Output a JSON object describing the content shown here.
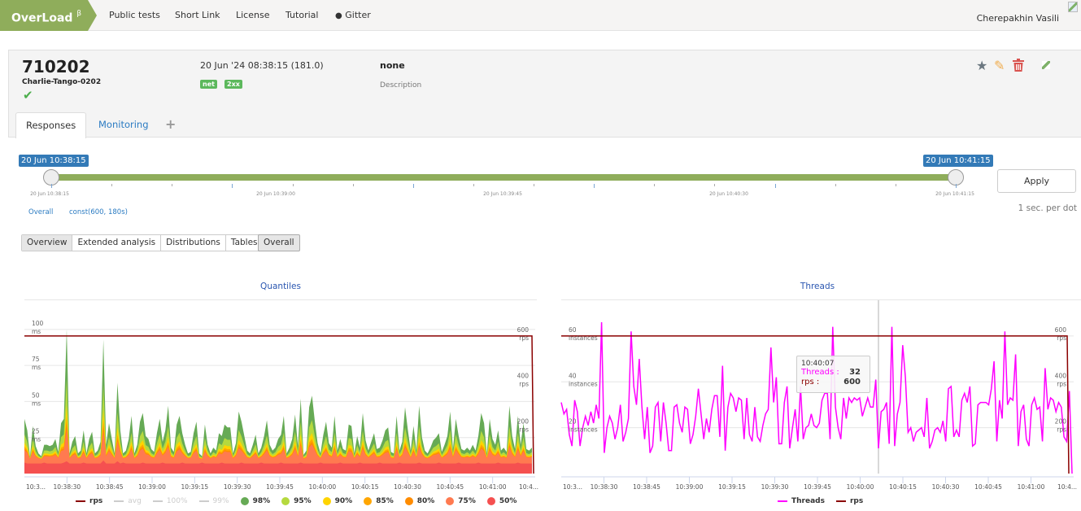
{
  "nav": {
    "logo": "OverLoad",
    "logo_sup": "β",
    "links": [
      "Public tests",
      "Short Link",
      "License",
      "Tutorial",
      "Gitter"
    ],
    "user": "Cherepakhin Vasili"
  },
  "test": {
    "id": "710202",
    "name": "Charlie-Tango-0202",
    "status_icon": "check-icon",
    "datetime": "20 Jun '24 08:38:15 (181.0)",
    "badges": [
      "net",
      "2xx"
    ],
    "status": "none",
    "description_placeholder": "Description",
    "actions": [
      "star-icon",
      "edit-icon",
      "delete-icon",
      "broken-image-icon"
    ]
  },
  "tabs": [
    {
      "label": "Responses",
      "active": true
    },
    {
      "label": "Monitoring",
      "active": false
    },
    {
      "label": "+",
      "active": false
    }
  ],
  "range": {
    "start": "20 Jun 10:38:15",
    "end": "20 Jun 10:41:15",
    "tick_labels": [
      "20 Jun 10:38:15",
      "20 Jun 10:39:00",
      "20 Jun 10:39:45",
      "20 Jun 10:40:30",
      "20 Jun 10:41:15"
    ],
    "apply_label": "Apply",
    "resolution": "1 sec. per dot",
    "links": [
      "Overall",
      "const(600, 180s)"
    ]
  },
  "view_buttons": [
    {
      "label": "Overview",
      "active": true
    },
    {
      "label": "Extended analysis",
      "active": false
    },
    {
      "label": "Distributions",
      "active": false
    },
    {
      "label": "Tables",
      "active": false
    }
  ],
  "ammo_button": "Overall",
  "tooltip": {
    "time": "10:40:07",
    "rows": [
      {
        "label": "Threads :",
        "value": "32",
        "color": "#ff00ff"
      },
      {
        "label": "rps :",
        "value": "600",
        "color": "#8b0000"
      }
    ]
  },
  "chart_data": [
    {
      "type": "area",
      "title": "Quantiles",
      "x_tick_labels": [
        "10:3...",
        "10:38:30",
        "10:38:45",
        "10:39:00",
        "10:39:15",
        "10:39:30",
        "10:39:45",
        "10:40:00",
        "10:40:15",
        "10:40:30",
        "10:40:45",
        "10:41:00",
        "10:4..."
      ],
      "y_left": {
        "unit": "ms",
        "ticks": [
          25,
          50,
          75,
          100
        ],
        "range": [
          0,
          105
        ]
      },
      "y_right": {
        "unit": "rps",
        "ticks": [
          200,
          400,
          600
        ],
        "range": [
          0,
          660
        ]
      },
      "legend": [
        {
          "name": "rps",
          "color": "#8b0000",
          "kind": "line",
          "enabled": true
        },
        {
          "name": "avg",
          "color": "#cccccc",
          "kind": "line",
          "enabled": false
        },
        {
          "name": "100%",
          "color": "#cccccc",
          "kind": "line",
          "enabled": false
        },
        {
          "name": "99%",
          "color": "#cccccc",
          "kind": "line",
          "enabled": false
        },
        {
          "name": "98%",
          "color": "#66aa55",
          "kind": "dot",
          "enabled": true
        },
        {
          "name": "95%",
          "color": "#b5d93e",
          "kind": "dot",
          "enabled": true
        },
        {
          "name": "90%",
          "color": "#ffd400",
          "kind": "dot",
          "enabled": true
        },
        {
          "name": "85%",
          "color": "#ffa600",
          "kind": "dot",
          "enabled": true
        },
        {
          "name": "80%",
          "color": "#ff8c00",
          "kind": "dot",
          "enabled": true
        },
        {
          "name": "75%",
          "color": "#ff7a50",
          "kind": "dot",
          "enabled": true
        },
        {
          "name": "50%",
          "color": "#f55050",
          "kind": "dot",
          "enabled": true
        }
      ],
      "rps_constant": 600,
      "q98": [
        38,
        30,
        12,
        33,
        19,
        14,
        12,
        20,
        20,
        19,
        20,
        24,
        15,
        35,
        38,
        100,
        14,
        22,
        26,
        14,
        16,
        30,
        14,
        24,
        29,
        14,
        16,
        22,
        93,
        20,
        35,
        24,
        14,
        63,
        30,
        14,
        16,
        24,
        40,
        14,
        20,
        36,
        42,
        26,
        24,
        17,
        15,
        28,
        38,
        22,
        30,
        47,
        18,
        15,
        34,
        40,
        28,
        20,
        14,
        15,
        28,
        36,
        14,
        12,
        34,
        20,
        14,
        18,
        16,
        28,
        26,
        34,
        32,
        32,
        14,
        21,
        43,
        36,
        26,
        16,
        14,
        20,
        27,
        14,
        18,
        26,
        37,
        20,
        16,
        18,
        24,
        27,
        40,
        14,
        18,
        24,
        41,
        19,
        52,
        13,
        16,
        46,
        54,
        36,
        21,
        14,
        27,
        36,
        21,
        18,
        40,
        16,
        24,
        17,
        16,
        34,
        33,
        14,
        26,
        18,
        42,
        23,
        16,
        22,
        28,
        17,
        18,
        23,
        30,
        32,
        15,
        14,
        40,
        16,
        22,
        46,
        30,
        16,
        33,
        16,
        47,
        25,
        16,
        14,
        18,
        23,
        25,
        28,
        15,
        20,
        26,
        43,
        17,
        38,
        26,
        17,
        16,
        18,
        16,
        20,
        16,
        26,
        42,
        35,
        14,
        38,
        24,
        20,
        30,
        16,
        18,
        15,
        47,
        26,
        17,
        40,
        20,
        35,
        17,
        16,
        18
      ],
      "q50_approx": 7,
      "x_start": "10:38:15",
      "x_end": "10:41:15",
      "points_per_second": 1
    },
    {
      "type": "line",
      "title": "Threads",
      "x_tick_labels": [
        "10:3...",
        "10:38:30",
        "10:38:45",
        "10:39:00",
        "10:39:15",
        "10:39:30",
        "10:39:45",
        "10:40:00",
        "10:40:15",
        "10:40:30",
        "10:40:45",
        "10:41:00",
        "10:4..."
      ],
      "y_left": {
        "unit": "instances",
        "ticks": [
          20,
          40,
          60
        ],
        "range": [
          0,
          66
        ]
      },
      "y_right": {
        "unit": "rps",
        "ticks": [
          200,
          400,
          600
        ],
        "range": [
          0,
          660
        ]
      },
      "legend": [
        {
          "name": "Threads",
          "color": "#ff00ff",
          "kind": "line"
        },
        {
          "name": "rps",
          "color": "#8b0000",
          "kind": "line"
        }
      ],
      "rps_constant": 600,
      "threads": [
        31,
        26,
        28,
        17,
        12,
        32,
        27,
        12,
        20,
        25,
        21,
        27,
        22,
        30,
        24,
        66,
        9,
        20,
        25,
        22,
        15,
        20,
        30,
        14,
        18,
        24,
        62,
        38,
        30,
        50,
        29,
        15,
        29,
        9,
        12,
        29,
        31,
        14,
        31,
        22,
        10,
        10,
        29,
        30,
        22,
        18,
        29,
        28,
        13,
        17,
        25,
        37,
        26,
        15,
        24,
        18,
        28,
        34,
        34,
        16,
        47,
        10,
        29,
        35,
        33,
        27,
        33,
        32,
        15,
        33,
        17,
        14,
        29,
        16,
        14,
        21,
        26,
        28,
        55,
        31,
        42,
        13,
        13,
        31,
        38,
        11,
        20,
        28,
        14,
        38,
        15,
        20,
        21,
        26,
        21,
        20,
        22,
        32,
        35,
        35,
        15,
        64,
        29,
        20,
        15,
        33,
        24,
        33,
        31,
        33,
        32,
        33,
        25,
        29,
        33,
        29,
        29,
        41,
        11,
        27,
        28,
        31,
        13,
        64,
        12,
        26,
        31,
        56,
        42,
        18,
        20,
        14,
        18,
        19,
        20,
        16,
        33,
        11,
        14,
        19,
        20,
        18,
        23,
        14,
        37,
        38,
        16,
        19,
        16,
        32,
        35,
        31,
        38,
        12,
        13,
        30,
        31,
        31,
        31,
        30,
        37,
        49,
        14,
        32,
        24,
        62,
        30,
        33,
        32,
        52,
        12,
        27,
        30,
        15,
        12,
        30,
        33,
        28,
        29,
        14,
        46,
        28,
        33,
        32,
        27,
        31,
        29,
        16,
        14,
        36,
        0
      ],
      "hover_time": "10:40:07",
      "hover_threads": 32,
      "hover_rps": 600
    }
  ]
}
